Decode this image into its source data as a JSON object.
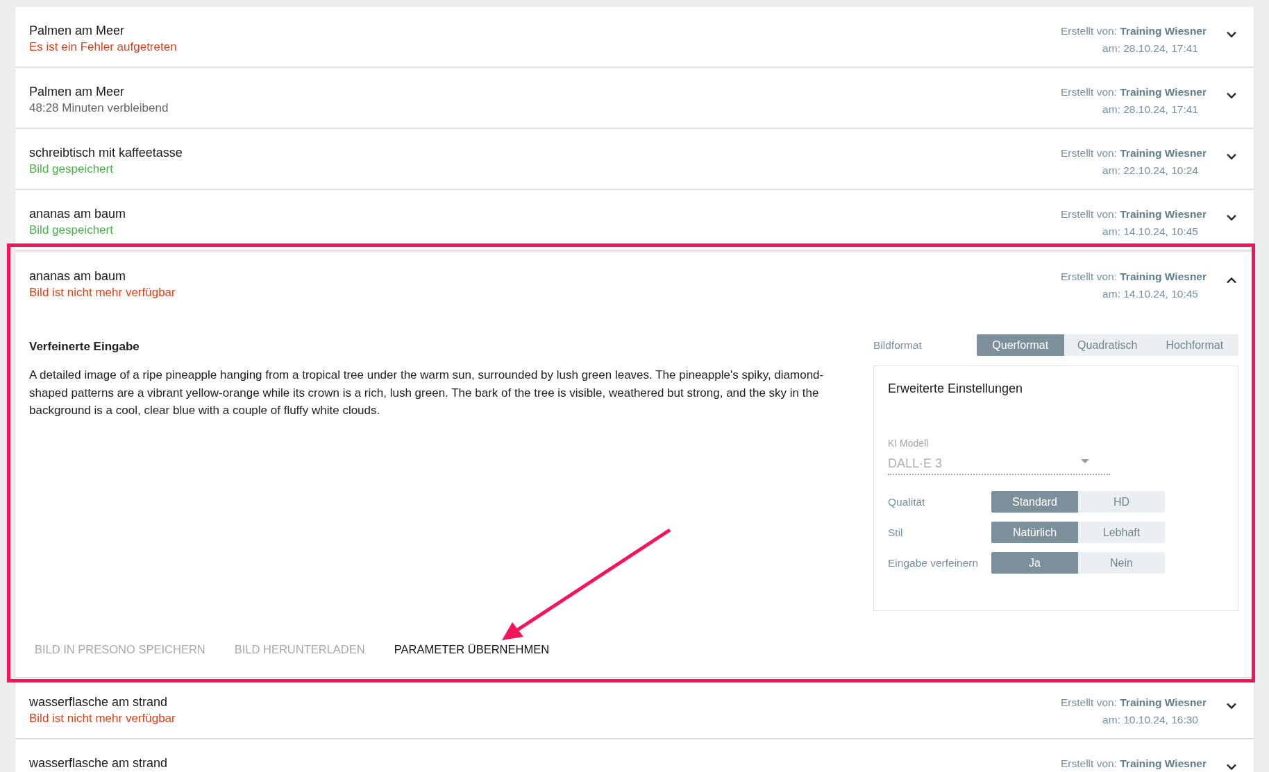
{
  "items": [
    {
      "title": "Palmen am Meer",
      "status": {
        "kind": "error",
        "text": "Es ist ein Fehler aufgetreten"
      },
      "created_label": "Erstellt von:",
      "author": "Training Wiesner",
      "date": "am: 28.10.24, 17:41",
      "expanded": false
    },
    {
      "title": "Palmen am Meer",
      "status": {
        "kind": "info",
        "text": "48:28 Minuten verbleibend"
      },
      "created_label": "Erstellt von:",
      "author": "Training Wiesner",
      "date": "am: 28.10.24, 17:41",
      "expanded": false
    },
    {
      "title": "schreibtisch mit kaffeetasse",
      "status": {
        "kind": "success",
        "text": "Bild gespeichert"
      },
      "created_label": "Erstellt von:",
      "author": "Training Wiesner",
      "date": "am: 22.10.24, 10:24",
      "expanded": false
    },
    {
      "title": "ananas am baum",
      "status": {
        "kind": "success",
        "text": "Bild gespeichert"
      },
      "created_label": "Erstellt von:",
      "author": "Training Wiesner",
      "date": "am: 14.10.24, 10:45",
      "expanded": false
    },
    {
      "title": "ananas am baum",
      "status": {
        "kind": "error",
        "text": "Bild ist nicht mehr verfügbar"
      },
      "created_label": "Erstellt von:",
      "author": "Training Wiesner",
      "date": "am: 14.10.24, 10:45",
      "expanded": true,
      "details": {
        "heading": "Verfeinerte Eingabe",
        "prompt": "A detailed image of a ripe pineapple hanging from a tropical tree under the warm sun, surrounded by lush green leaves. The pineapple's spiky, diamond-shaped patterns are a vibrant yellow-orange while its crown is a rich, lush green. The bark of the tree is visible, weathered but strong, and the sky in the background is a cool, clear blue with a couple of fluffy white clouds.",
        "format": {
          "label": "Bildformat",
          "options": [
            {
              "label": "Querformat",
              "selected": true
            },
            {
              "label": "Quadratisch",
              "selected": false
            },
            {
              "label": "Hochformat",
              "selected": false
            }
          ]
        },
        "settings": {
          "title": "Erweiterte Einstellungen",
          "model": {
            "label": "KI Modell",
            "value": "DALL·E 3",
            "disabled": true
          },
          "rows": [
            {
              "label": "Qualität",
              "options": [
                {
                  "label": "Standard",
                  "selected": true
                },
                {
                  "label": "HD",
                  "selected": false
                }
              ]
            },
            {
              "label": "Stil",
              "options": [
                {
                  "label": "Natürlich",
                  "selected": true
                },
                {
                  "label": "Lebhaft",
                  "selected": false
                }
              ]
            },
            {
              "label": "Eingabe verfeinern",
              "options": [
                {
                  "label": "Ja",
                  "selected": true
                },
                {
                  "label": "Nein",
                  "selected": false
                }
              ]
            }
          ]
        },
        "actions": [
          {
            "label": "BILD IN PRESONO SPEICHERN",
            "disabled": true
          },
          {
            "label": "BILD HERUNTERLADEN",
            "disabled": true
          },
          {
            "label": "PARAMETER ÜBERNEHMEN",
            "disabled": false
          }
        ]
      }
    },
    {
      "title": "wasserflasche am strand",
      "status": {
        "kind": "error",
        "text": "Bild ist nicht mehr verfügbar"
      },
      "created_label": "Erstellt von:",
      "author": "Training Wiesner",
      "date": "am: 10.10.24, 16:30",
      "expanded": false
    },
    {
      "title": "wasserflasche am strand",
      "created_label": "Erstellt von:",
      "author": "Training Wiesner",
      "expanded": false
    }
  ],
  "annotations": {
    "highlight_frame": true,
    "arrow": true
  }
}
